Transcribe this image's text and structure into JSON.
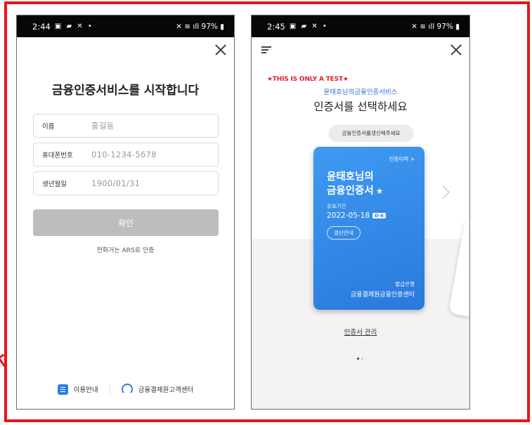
{
  "left_screen": {
    "status": {
      "time": "2:44",
      "battery": "97%"
    },
    "title": "금융인증서비스를 시작합니다",
    "fields": [
      {
        "label": "이름",
        "value": "홍길동"
      },
      {
        "label": "휴대폰번호",
        "value": "010-1234-5678"
      },
      {
        "label": "생년월일",
        "value": "1900/01/31"
      }
    ],
    "confirm_label": "확인",
    "ars_link": "전화거는 ARS로 인증",
    "footer": {
      "guide_label": "이용안내",
      "center_label": "금융결제원고객센터"
    }
  },
  "right_screen": {
    "status": {
      "time": "2:45",
      "battery": "97%"
    },
    "test_label": "★THIS IS ONLY A TEST★",
    "subtitle": "윤태호님의금융인증서비스",
    "title": "인증서를 선택하세요",
    "renew_pill": "금융인증서를갱신해주세요",
    "card": {
      "history_link": "인증이력 >",
      "owner_line1": "윤태호님의",
      "owner_line2": "금융인증서",
      "expiry_label": "유효기간",
      "expiry_date": "2022-05-18",
      "dday": "D-6",
      "renew_button": "갱신안내",
      "issuer_label": "발급은행",
      "issuer": "금융결제원금융인증센터"
    },
    "manage_link": "인증서 관리"
  },
  "colors": {
    "accent_blue": "#2f7fe0",
    "card_blue": "#2979dc",
    "test_red": "#e0202a",
    "frame_red": "#e8141b",
    "button_grey": "#bdbdbd"
  },
  "icons": [
    "close-icon",
    "menu-icon",
    "chevron-right-icon",
    "star-icon",
    "guide-icon",
    "headset-icon"
  ]
}
